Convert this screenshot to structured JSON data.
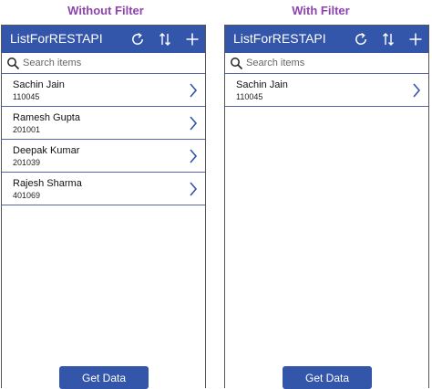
{
  "captions": {
    "left": "Without Filter",
    "right": "With Filter"
  },
  "panels": [
    {
      "title": "ListForRESTAPI",
      "search_placeholder": "Search items",
      "items": [
        {
          "name": "Sachin Jain",
          "number": "110045"
        },
        {
          "name": "Ramesh Gupta",
          "number": "201001"
        },
        {
          "name": "Deepak Kumar",
          "number": "201039"
        },
        {
          "name": "Rajesh Sharma",
          "number": "401069"
        }
      ],
      "button_label": "Get Data"
    },
    {
      "title": "ListForRESTAPI",
      "search_placeholder": "Search items",
      "items": [
        {
          "name": "Sachin Jain",
          "number": "110045"
        }
      ],
      "button_label": "Get Data"
    }
  ],
  "icons": [
    "refresh-icon",
    "sort-icon",
    "add-icon",
    "search-icon",
    "chevron-right-icon"
  ],
  "colors": {
    "header": "#3355aa",
    "caption": "#8e44ad",
    "divider": "#5566aa",
    "button": "#3355aa"
  }
}
